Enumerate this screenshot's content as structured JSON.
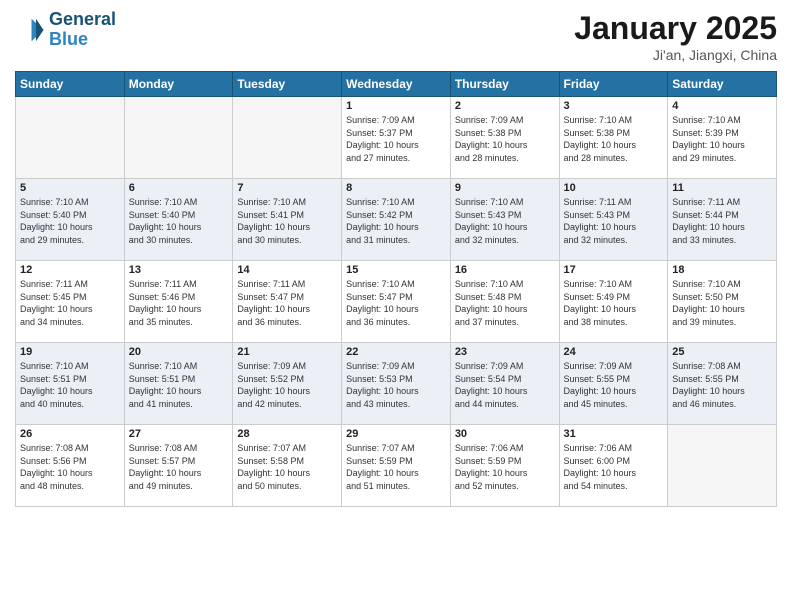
{
  "logo": {
    "line1": "General",
    "line2": "Blue"
  },
  "title": "January 2025",
  "subtitle": "Ji'an, Jiangxi, China",
  "weekdays": [
    "Sunday",
    "Monday",
    "Tuesday",
    "Wednesday",
    "Thursday",
    "Friday",
    "Saturday"
  ],
  "weeks": [
    [
      {
        "day": "",
        "info": "",
        "empty": true
      },
      {
        "day": "",
        "info": "",
        "empty": true
      },
      {
        "day": "",
        "info": "",
        "empty": true
      },
      {
        "day": "1",
        "info": "Sunrise: 7:09 AM\nSunset: 5:37 PM\nDaylight: 10 hours\nand 27 minutes.",
        "empty": false
      },
      {
        "day": "2",
        "info": "Sunrise: 7:09 AM\nSunset: 5:38 PM\nDaylight: 10 hours\nand 28 minutes.",
        "empty": false
      },
      {
        "day": "3",
        "info": "Sunrise: 7:10 AM\nSunset: 5:38 PM\nDaylight: 10 hours\nand 28 minutes.",
        "empty": false
      },
      {
        "day": "4",
        "info": "Sunrise: 7:10 AM\nSunset: 5:39 PM\nDaylight: 10 hours\nand 29 minutes.",
        "empty": false
      }
    ],
    [
      {
        "day": "5",
        "info": "Sunrise: 7:10 AM\nSunset: 5:40 PM\nDaylight: 10 hours\nand 29 minutes.",
        "empty": false,
        "shaded": true
      },
      {
        "day": "6",
        "info": "Sunrise: 7:10 AM\nSunset: 5:40 PM\nDaylight: 10 hours\nand 30 minutes.",
        "empty": false,
        "shaded": true
      },
      {
        "day": "7",
        "info": "Sunrise: 7:10 AM\nSunset: 5:41 PM\nDaylight: 10 hours\nand 30 minutes.",
        "empty": false,
        "shaded": true
      },
      {
        "day": "8",
        "info": "Sunrise: 7:10 AM\nSunset: 5:42 PM\nDaylight: 10 hours\nand 31 minutes.",
        "empty": false,
        "shaded": true
      },
      {
        "day": "9",
        "info": "Sunrise: 7:10 AM\nSunset: 5:43 PM\nDaylight: 10 hours\nand 32 minutes.",
        "empty": false,
        "shaded": true
      },
      {
        "day": "10",
        "info": "Sunrise: 7:11 AM\nSunset: 5:43 PM\nDaylight: 10 hours\nand 32 minutes.",
        "empty": false,
        "shaded": true
      },
      {
        "day": "11",
        "info": "Sunrise: 7:11 AM\nSunset: 5:44 PM\nDaylight: 10 hours\nand 33 minutes.",
        "empty": false,
        "shaded": true
      }
    ],
    [
      {
        "day": "12",
        "info": "Sunrise: 7:11 AM\nSunset: 5:45 PM\nDaylight: 10 hours\nand 34 minutes.",
        "empty": false
      },
      {
        "day": "13",
        "info": "Sunrise: 7:11 AM\nSunset: 5:46 PM\nDaylight: 10 hours\nand 35 minutes.",
        "empty": false
      },
      {
        "day": "14",
        "info": "Sunrise: 7:11 AM\nSunset: 5:47 PM\nDaylight: 10 hours\nand 36 minutes.",
        "empty": false
      },
      {
        "day": "15",
        "info": "Sunrise: 7:10 AM\nSunset: 5:47 PM\nDaylight: 10 hours\nand 36 minutes.",
        "empty": false
      },
      {
        "day": "16",
        "info": "Sunrise: 7:10 AM\nSunset: 5:48 PM\nDaylight: 10 hours\nand 37 minutes.",
        "empty": false
      },
      {
        "day": "17",
        "info": "Sunrise: 7:10 AM\nSunset: 5:49 PM\nDaylight: 10 hours\nand 38 minutes.",
        "empty": false
      },
      {
        "day": "18",
        "info": "Sunrise: 7:10 AM\nSunset: 5:50 PM\nDaylight: 10 hours\nand 39 minutes.",
        "empty": false
      }
    ],
    [
      {
        "day": "19",
        "info": "Sunrise: 7:10 AM\nSunset: 5:51 PM\nDaylight: 10 hours\nand 40 minutes.",
        "empty": false,
        "shaded": true
      },
      {
        "day": "20",
        "info": "Sunrise: 7:10 AM\nSunset: 5:51 PM\nDaylight: 10 hours\nand 41 minutes.",
        "empty": false,
        "shaded": true
      },
      {
        "day": "21",
        "info": "Sunrise: 7:09 AM\nSunset: 5:52 PM\nDaylight: 10 hours\nand 42 minutes.",
        "empty": false,
        "shaded": true
      },
      {
        "day": "22",
        "info": "Sunrise: 7:09 AM\nSunset: 5:53 PM\nDaylight: 10 hours\nand 43 minutes.",
        "empty": false,
        "shaded": true
      },
      {
        "day": "23",
        "info": "Sunrise: 7:09 AM\nSunset: 5:54 PM\nDaylight: 10 hours\nand 44 minutes.",
        "empty": false,
        "shaded": true
      },
      {
        "day": "24",
        "info": "Sunrise: 7:09 AM\nSunset: 5:55 PM\nDaylight: 10 hours\nand 45 minutes.",
        "empty": false,
        "shaded": true
      },
      {
        "day": "25",
        "info": "Sunrise: 7:08 AM\nSunset: 5:55 PM\nDaylight: 10 hours\nand 46 minutes.",
        "empty": false,
        "shaded": true
      }
    ],
    [
      {
        "day": "26",
        "info": "Sunrise: 7:08 AM\nSunset: 5:56 PM\nDaylight: 10 hours\nand 48 minutes.",
        "empty": false
      },
      {
        "day": "27",
        "info": "Sunrise: 7:08 AM\nSunset: 5:57 PM\nDaylight: 10 hours\nand 49 minutes.",
        "empty": false
      },
      {
        "day": "28",
        "info": "Sunrise: 7:07 AM\nSunset: 5:58 PM\nDaylight: 10 hours\nand 50 minutes.",
        "empty": false
      },
      {
        "day": "29",
        "info": "Sunrise: 7:07 AM\nSunset: 5:59 PM\nDaylight: 10 hours\nand 51 minutes.",
        "empty": false
      },
      {
        "day": "30",
        "info": "Sunrise: 7:06 AM\nSunset: 5:59 PM\nDaylight: 10 hours\nand 52 minutes.",
        "empty": false
      },
      {
        "day": "31",
        "info": "Sunrise: 7:06 AM\nSunset: 6:00 PM\nDaylight: 10 hours\nand 54 minutes.",
        "empty": false
      },
      {
        "day": "",
        "info": "",
        "empty": true
      }
    ]
  ]
}
